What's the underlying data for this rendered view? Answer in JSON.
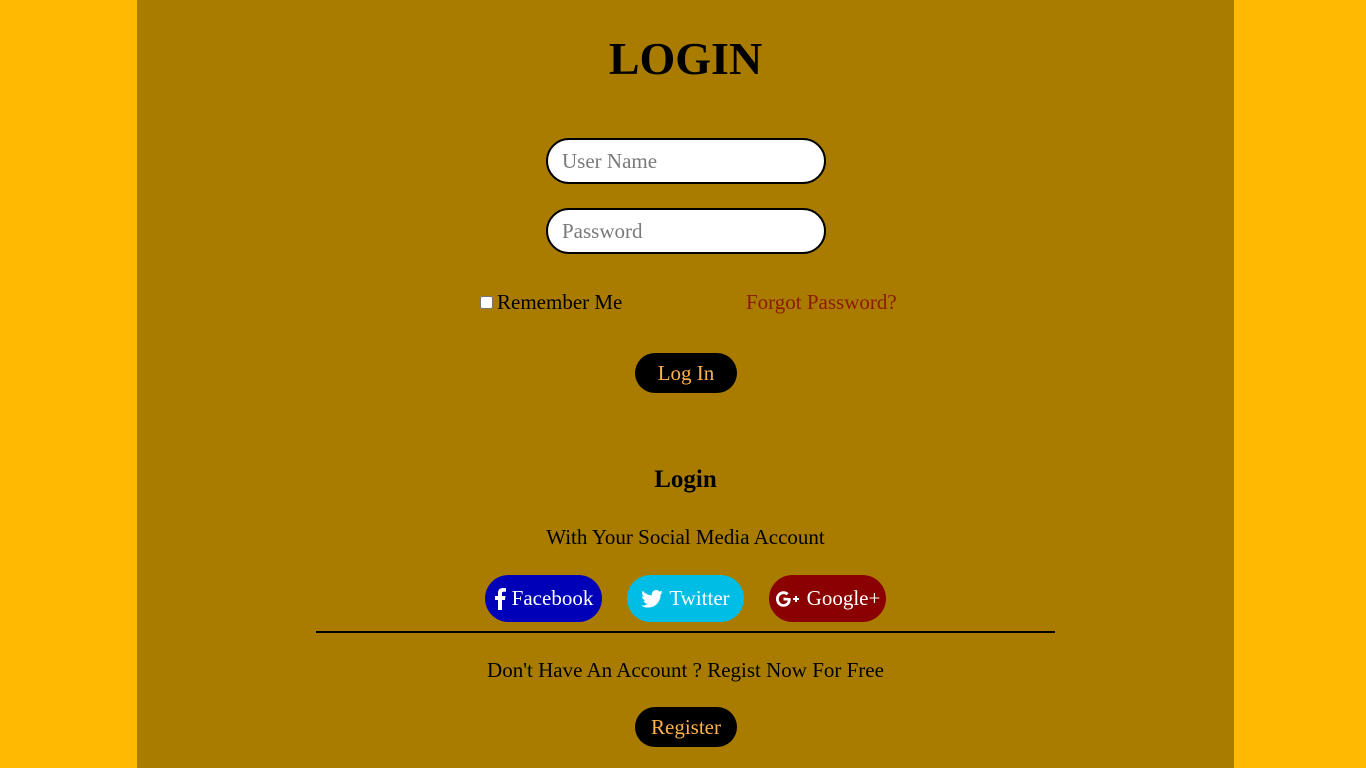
{
  "login_form": {
    "title": "LOGIN",
    "username_placeholder": "User Name",
    "username_value": "",
    "password_placeholder": "Password",
    "password_value": "",
    "remember_label": "Remember Me",
    "remember_checked": false,
    "forgot_link": "Forgot Password?",
    "login_button": "Log In"
  },
  "social": {
    "heading": "Login",
    "subheading": "With Your Social Media Account",
    "buttons": [
      {
        "label": "Facebook",
        "icon": "facebook-icon",
        "color": "#0000B8"
      },
      {
        "label": "Twitter",
        "icon": "twitter-icon",
        "color": "#00BDE6"
      },
      {
        "label": "Google+",
        "icon": "google-plus-icon",
        "color": "#8B0000"
      }
    ]
  },
  "register": {
    "text": "Don't Have An Account ? Regist Now For Free",
    "button": "Register"
  },
  "colors": {
    "page_background": "#FFB900",
    "panel_background": "#A97C00",
    "button_dark": "#000000",
    "button_text": "#FFB14A",
    "link": "#8B1A00"
  }
}
